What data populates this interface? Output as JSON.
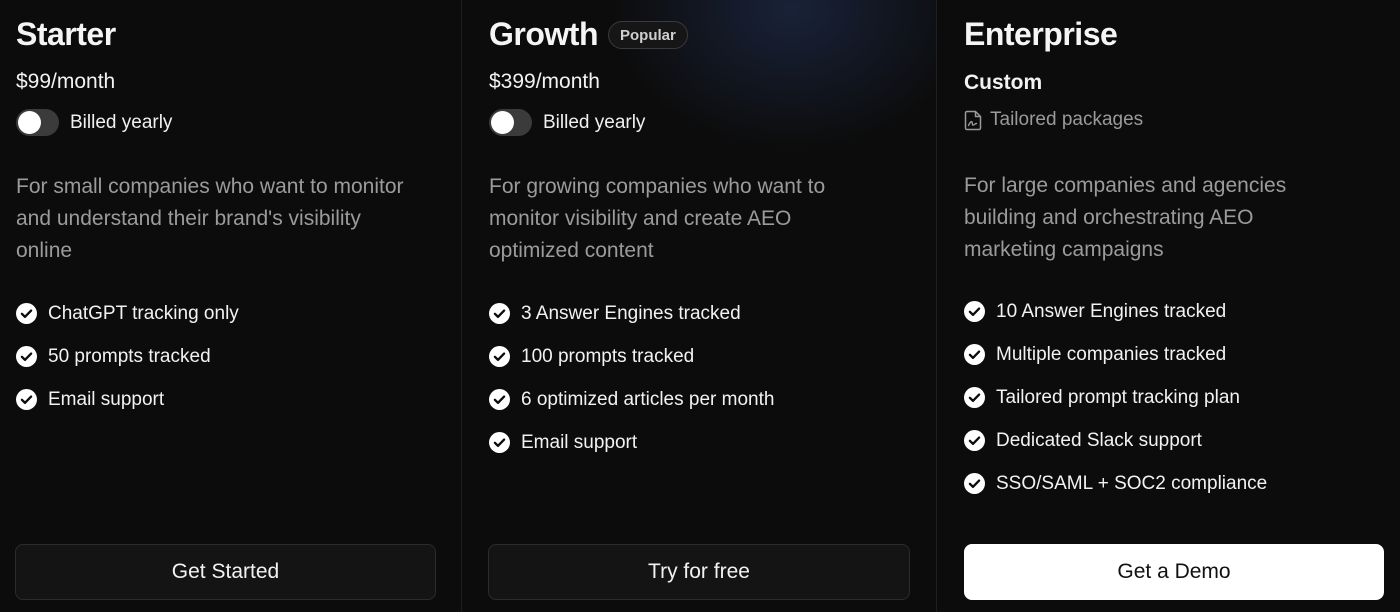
{
  "plans": {
    "starter": {
      "name": "Starter",
      "price": "$99/month",
      "billing_label": "Billed yearly",
      "billed_yearly": false,
      "description": "For small companies who want to monitor and understand their brand's visibility online",
      "features": [
        "ChatGPT tracking only",
        "50 prompts tracked",
        "Email support"
      ],
      "cta": "Get Started"
    },
    "growth": {
      "name": "Growth",
      "badge": "Popular",
      "price": "$399/month",
      "billing_label": "Billed yearly",
      "billed_yearly": false,
      "description": "For growing companies who want to monitor visibility and create AEO optimized content",
      "features": [
        "3 Answer Engines tracked",
        "100 prompts tracked",
        "6 optimized articles per month",
        "Email support"
      ],
      "cta": "Try for free"
    },
    "enterprise": {
      "name": "Enterprise",
      "price": "Custom",
      "subtext": "Tailored packages",
      "subtext_icon": "file-signature-icon",
      "description": "For large companies and agencies building and orchestrating AEO marketing campaigns",
      "features": [
        "10 Answer Engines tracked",
        "Multiple companies tracked",
        "Tailored prompt tracking plan",
        "Dedicated Slack support",
        "SSO/SAML + SOC2 compliance"
      ],
      "cta": "Get a Demo"
    }
  },
  "colors": {
    "background": "#0c0c0c",
    "muted_text": "#9b9b9b",
    "toggle_off": "#3b3b3b",
    "cta_light": "#ffffff"
  },
  "icons": {
    "feature": "check-circle-icon"
  }
}
